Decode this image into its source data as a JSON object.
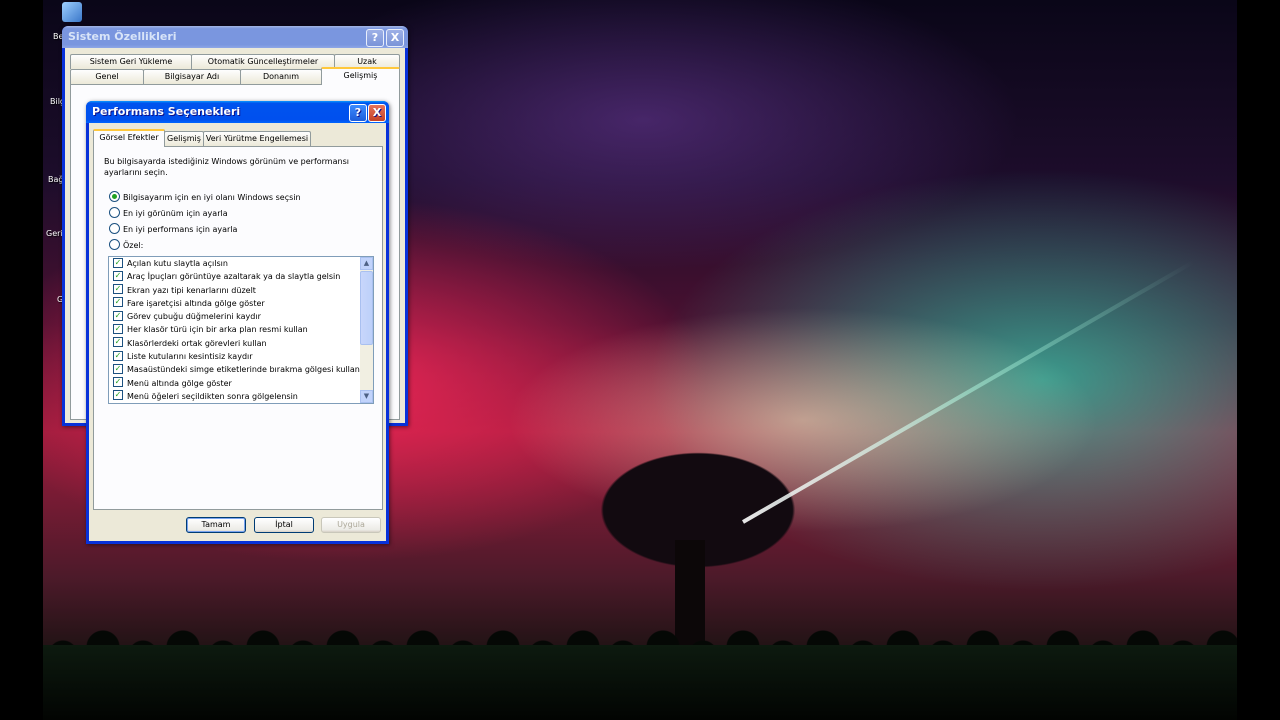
{
  "desktop": {
    "icon_labels": [
      "Be",
      "Bilg",
      "Bağ",
      "Geri",
      "G"
    ]
  },
  "system_properties": {
    "title": "Sistem Özellikleri",
    "title_buttons": {
      "help": "?",
      "close": "X"
    },
    "tabs_row1": [
      "Sistem Geri Yükleme",
      "Otomatik Güncelleştirmeler",
      "Uzak"
    ],
    "tabs_row2": [
      "Genel",
      "Bilgisayar Adı",
      "Donanım",
      "Gelişmiş"
    ],
    "selected_tab": "Gelişmiş"
  },
  "performance_options": {
    "title": "Performans Seçenekleri",
    "title_buttons": {
      "help": "?",
      "close": "X"
    },
    "tabs": [
      "Görsel Efektler",
      "Gelişmiş",
      "Veri Yürütme Engellemesi"
    ],
    "selected_tab": "Görsel Efektler",
    "description": "Bu bilgisayarda istediğiniz Windows görünüm ve performansı ayarlarını seçin.",
    "radio_options": [
      {
        "label": "Bilgisayarım için en iyi olanı Windows seçsin",
        "checked": true
      },
      {
        "label": "En iyi görünüm için ayarla",
        "checked": false
      },
      {
        "label": "En iyi performans için ayarla",
        "checked": false
      },
      {
        "label": "Özel:",
        "checked": false
      }
    ],
    "effects": [
      {
        "label": "Açılan kutu slaytla açılsın",
        "checked": true
      },
      {
        "label": "Araç İpuçları görüntüye azaltarak ya da slaytla gelsin",
        "checked": true
      },
      {
        "label": "Ekran yazı tipi kenarlarını düzelt",
        "checked": true
      },
      {
        "label": "Fare işaretçisi altında gölge göster",
        "checked": true
      },
      {
        "label": "Görev çubuğu düğmelerini kaydır",
        "checked": true
      },
      {
        "label": "Her klasör türü için bir arka plan resmi kullan",
        "checked": true
      },
      {
        "label": "Klasörlerdeki ortak görevleri kullan",
        "checked": true
      },
      {
        "label": "Liste kutularını kesintisiz kaydır",
        "checked": true
      },
      {
        "label": "Masaüstündeki simge etiketlerinde bırakma gölgesi kullan",
        "checked": true
      },
      {
        "label": "Menü altında gölge göster",
        "checked": true
      },
      {
        "label": "Menü öğeleri seçildikten sonra gölgelensin",
        "checked": true
      }
    ],
    "buttons": {
      "ok": "Tamam",
      "cancel": "İptal",
      "apply": "Uygula"
    }
  }
}
